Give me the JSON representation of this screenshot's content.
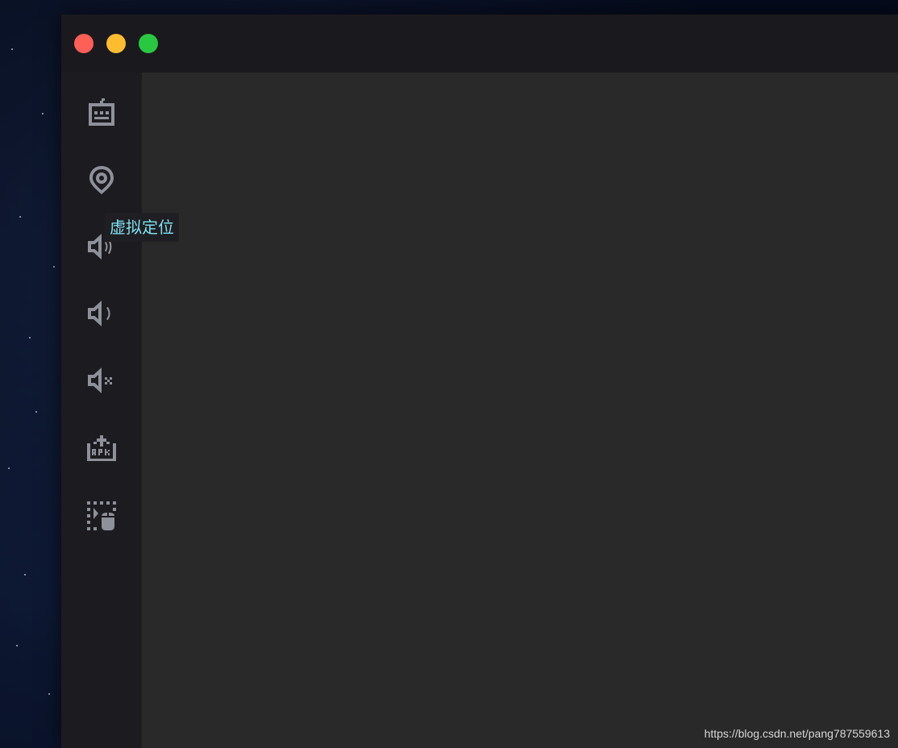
{
  "window": {
    "traffic_lights": {
      "close_color": "#fe5f57",
      "minimize_color": "#febc2e",
      "zoom_color": "#28c840"
    }
  },
  "sidebar": {
    "items": [
      {
        "icon": "keyboard-icon"
      },
      {
        "icon": "location-pin-icon"
      },
      {
        "icon": "volume-up-icon"
      },
      {
        "icon": "volume-down-icon"
      },
      {
        "icon": "mute-icon"
      },
      {
        "icon": "apk-upload-icon"
      },
      {
        "icon": "mouse-control-icon"
      }
    ],
    "icon_color": "#8e909a"
  },
  "tooltip": {
    "text": "虚拟定位",
    "color": "#7fe0f0"
  },
  "watermark": {
    "text": "https://blog.csdn.net/pang787559613"
  }
}
